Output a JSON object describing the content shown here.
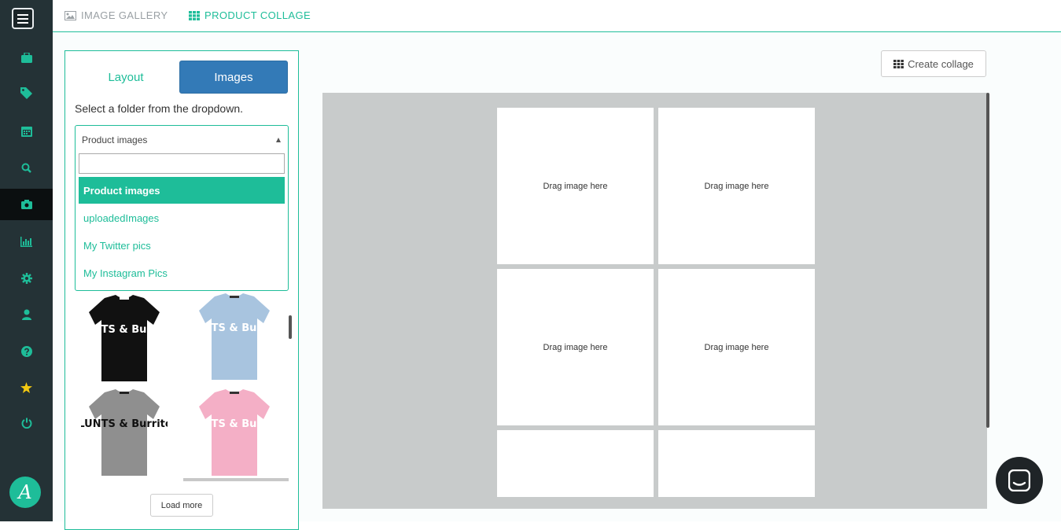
{
  "sidebar": {
    "items": [
      {
        "icon": "briefcase-icon"
      },
      {
        "icon": "tags-icon"
      },
      {
        "icon": "calendar-icon"
      },
      {
        "icon": "search-icon"
      },
      {
        "icon": "camera-icon",
        "active": true
      },
      {
        "icon": "bar-chart-icon"
      },
      {
        "icon": "gear-icon"
      },
      {
        "icon": "user-icon"
      },
      {
        "icon": "help-icon"
      },
      {
        "icon": "star-icon"
      },
      {
        "icon": "power-icon"
      }
    ],
    "brand_letter": "A"
  },
  "tabs": {
    "gallery": "IMAGE GALLERY",
    "collage": "PRODUCT COLLAGE"
  },
  "panel": {
    "layout_tab": "Layout",
    "images_tab": "Images",
    "instruction": "Select a folder from the dropdown.",
    "dropdown": {
      "selected": "Product images",
      "search_value": "",
      "options": [
        "Product images",
        "uploadedImages",
        "My Twitter pics",
        "My Instagram Pics"
      ]
    },
    "thumbnails": [
      {
        "color": "black",
        "text": "BLUNTS & Burritos"
      },
      {
        "color": "light-blue",
        "text": "BLUNTS & Burritos"
      },
      {
        "color": "grey",
        "text": "BLUNTS & Burritos"
      },
      {
        "color": "pink",
        "text": "BLUNTS & Burritos"
      }
    ],
    "load_more": "Load more"
  },
  "create_collage": "Create collage",
  "collage": {
    "cells": [
      "Drag image here",
      "Drag image here",
      "Drag image here",
      "Drag image here",
      "",
      ""
    ]
  },
  "colors": {
    "accent": "#1ebd99",
    "primary_button": "#337ab7",
    "sidebar_bg": "#243236",
    "canvas_bg": "#c8cbcb"
  }
}
